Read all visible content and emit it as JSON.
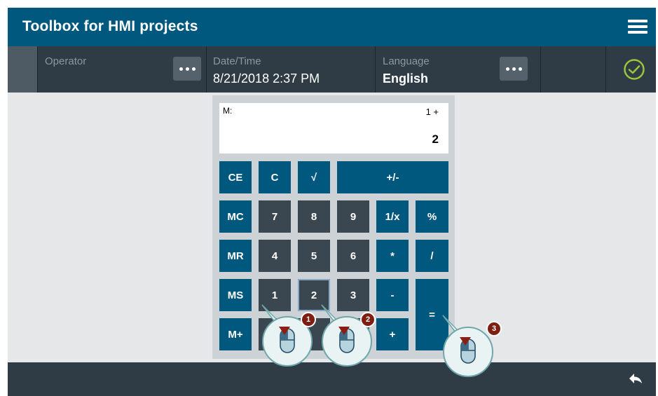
{
  "header": {
    "title": "Toolbox for HMI projects",
    "menu_icon": "hamburger-menu-icon"
  },
  "info_bar": {
    "operator_label": "Operator",
    "datetime_label": "Date/Time",
    "datetime_value": "8/21/2018 2:37 PM",
    "language_label": "Language",
    "language_value": "English",
    "status_icon": "checkmark-circle-icon",
    "status_color": "#9bc53d"
  },
  "calculator": {
    "memory_label": "M:",
    "operation": "1 +",
    "display_value": "2",
    "keys": {
      "ce": "CE",
      "c": "C",
      "sqrt": "√",
      "plusminus": "+/-",
      "mc": "MC",
      "k7": "7",
      "k8": "8",
      "k9": "9",
      "reciprocal": "1/x",
      "percent": "%",
      "mr": "MR",
      "k4": "4",
      "k5": "5",
      "k6": "6",
      "multiply": "*",
      "divide": "/",
      "ms": "MS",
      "k1": "1",
      "k2": "2",
      "k3": "3",
      "minus": "-",
      "equals": "=",
      "mplus": "M+",
      "plus": "+"
    }
  },
  "callouts": {
    "step1": "1",
    "step2": "2",
    "step3": "3"
  },
  "footer": {
    "back_icon": "back-arrow-icon"
  },
  "colors": {
    "accent": "#00587e",
    "dark": "#2f3c45",
    "key_dark": "#3b4750"
  }
}
